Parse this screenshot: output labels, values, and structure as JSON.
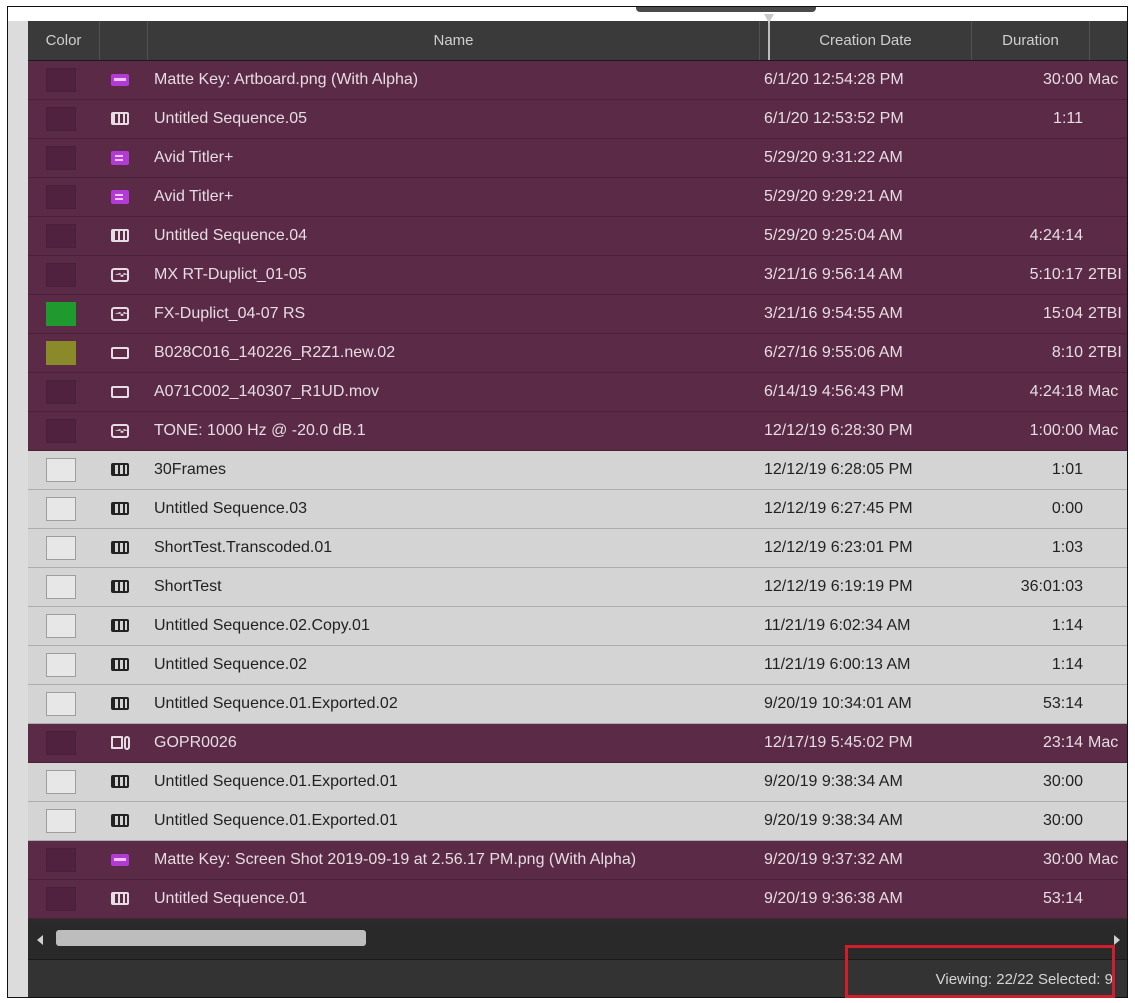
{
  "headers": {
    "color": "Color",
    "name": "Name",
    "creation_date": "Creation Date",
    "duration": "Duration"
  },
  "rows": [
    {
      "selected": true,
      "color": "",
      "icon": "matte-key-icon",
      "name": "Matte Key: Artboard.png (With Alpha)",
      "date": "6/1/20 12:54:28 PM",
      "duration": "30:00",
      "drive": "Mac"
    },
    {
      "selected": true,
      "color": "",
      "icon": "sequence-icon",
      "name": "Untitled Sequence.05",
      "date": "6/1/20 12:53:52 PM",
      "duration": "1:11",
      "drive": ""
    },
    {
      "selected": true,
      "color": "",
      "icon": "titler-icon",
      "name": "Avid Titler+",
      "date": "5/29/20 9:31:22 AM",
      "duration": "",
      "drive": ""
    },
    {
      "selected": true,
      "color": "",
      "icon": "titler-icon",
      "name": "Avid Titler+",
      "date": "5/29/20 9:29:21 AM",
      "duration": "",
      "drive": ""
    },
    {
      "selected": true,
      "color": "",
      "icon": "sequence-icon",
      "name": "Untitled Sequence.04",
      "date": "5/29/20 9:25:04 AM",
      "duration": "4:24:14",
      "drive": ""
    },
    {
      "selected": true,
      "color": "",
      "icon": "audio-clip-icon",
      "name": "MX RT-Duplict_01-05",
      "date": "3/21/16 9:56:14 AM",
      "duration": "5:10:17",
      "drive": "2TBI"
    },
    {
      "selected": true,
      "color": "#1e9a2e",
      "icon": "audio-clip-icon",
      "name": "FX-Duplict_04-07 RS",
      "date": "3/21/16 9:54:55 AM",
      "duration": "15:04",
      "drive": "2TBI"
    },
    {
      "selected": true,
      "color": "#8a8a2a",
      "icon": "master-clip-icon",
      "name": "B028C016_140226_R2Z1.new.02",
      "date": "6/27/16 9:55:06 AM",
      "duration": "8:10",
      "drive": "2TBI"
    },
    {
      "selected": true,
      "color": "",
      "icon": "master-clip-icon",
      "name": "A071C002_140307_R1UD.mov",
      "date": "6/14/19 4:56:43 PM",
      "duration": "4:24:18",
      "drive": "Mac"
    },
    {
      "selected": true,
      "color": "",
      "icon": "audio-clip-icon",
      "name": "TONE: 1000 Hz @ -20.0 dB.1",
      "date": "12/12/19 6:28:30 PM",
      "duration": "1:00:00",
      "drive": "Mac"
    },
    {
      "selected": false,
      "color": "",
      "icon": "sequence-icon",
      "name": "30Frames",
      "date": "12/12/19 6:28:05 PM",
      "duration": "1:01",
      "drive": ""
    },
    {
      "selected": false,
      "color": "",
      "icon": "sequence-icon",
      "name": "Untitled Sequence.03",
      "date": "12/12/19 6:27:45 PM",
      "duration": "0:00",
      "drive": ""
    },
    {
      "selected": false,
      "color": "",
      "icon": "sequence-icon",
      "name": "ShortTest.Transcoded.01",
      "date": "12/12/19 6:23:01 PM",
      "duration": "1:03",
      "drive": ""
    },
    {
      "selected": false,
      "color": "",
      "icon": "sequence-icon",
      "name": "ShortTest",
      "date": "12/12/19 6:19:19 PM",
      "duration": "36:01:03",
      "drive": ""
    },
    {
      "selected": false,
      "color": "",
      "icon": "sequence-icon",
      "name": "Untitled Sequence.02.Copy.01",
      "date": "11/21/19 6:02:34 AM",
      "duration": "1:14",
      "drive": ""
    },
    {
      "selected": false,
      "color": "",
      "icon": "sequence-icon",
      "name": "Untitled Sequence.02",
      "date": "11/21/19 6:00:13 AM",
      "duration": "1:14",
      "drive": ""
    },
    {
      "selected": false,
      "color": "",
      "icon": "sequence-icon",
      "name": "Untitled Sequence.01.Exported.02",
      "date": "9/20/19 10:34:01 AM",
      "duration": "53:14",
      "drive": ""
    },
    {
      "selected": true,
      "color": "",
      "icon": "linked-clip-icon",
      "name": "GOPR0026",
      "date": "12/17/19 5:45:02 PM",
      "duration": "23:14",
      "drive": "Mac"
    },
    {
      "selected": false,
      "color": "",
      "icon": "sequence-icon",
      "name": "Untitled Sequence.01.Exported.01",
      "date": "9/20/19 9:38:34 AM",
      "duration": "30:00",
      "drive": ""
    },
    {
      "selected": false,
      "color": "",
      "icon": "sequence-icon",
      "name": "Untitled Sequence.01.Exported.01",
      "date": "9/20/19 9:38:34 AM",
      "duration": "30:00",
      "drive": ""
    },
    {
      "selected": true,
      "color": "",
      "icon": "matte-key-icon",
      "name": "Matte Key: Screen Shot 2019-09-19 at 2.56.17 PM.png (With Alpha)",
      "date": "9/20/19 9:37:32 AM",
      "duration": "30:00",
      "drive": "Mac"
    },
    {
      "selected": true,
      "color": "",
      "icon": "sequence-icon",
      "name": "Untitled Sequence.01",
      "date": "9/20/19 9:36:38 AM",
      "duration": "53:14",
      "drive": ""
    }
  ],
  "status": {
    "text": "Viewing: 22/22  Selected: 9"
  },
  "colors": {
    "selected_row": "#5a2a46",
    "unselected_row": "#d4d4d4",
    "highlight": "#d01e2c"
  }
}
